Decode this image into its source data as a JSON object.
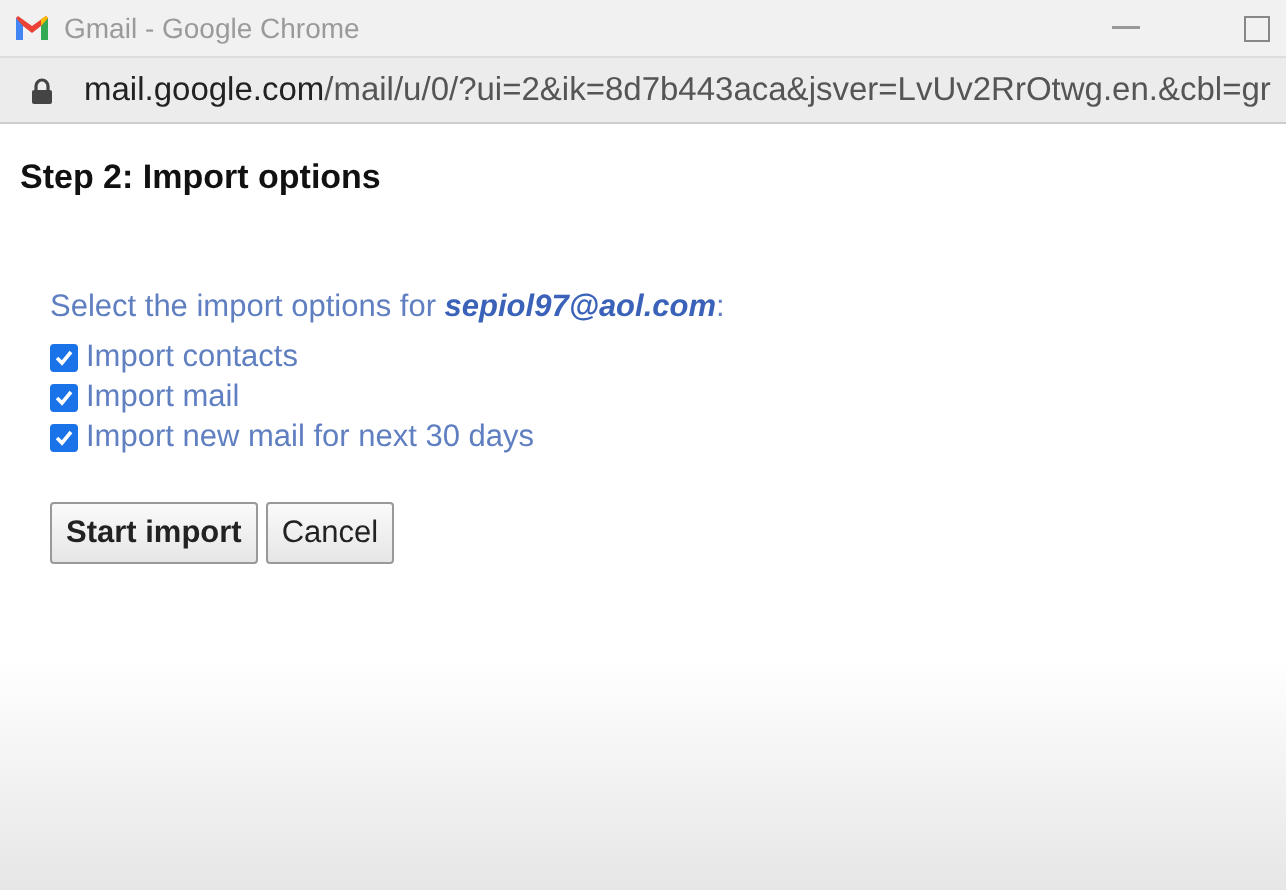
{
  "window": {
    "title": "Gmail - Google Chrome"
  },
  "address_bar": {
    "host": "mail.google.com",
    "path": "/mail/u/0/?ui=2&ik=8d7b443aca&jsver=LvUv2RrOtwg.en.&cbl=gr"
  },
  "heading": "Step 2: Import options",
  "prompt": {
    "text": "Select the import options for ",
    "email": "sepiol97@aol.com",
    "suffix": ":"
  },
  "options": [
    {
      "label": "Import contacts",
      "checked": true
    },
    {
      "label": "Import mail",
      "checked": true
    },
    {
      "label": "Import new mail for next 30 days",
      "checked": true
    }
  ],
  "buttons": [
    {
      "label": "Start import",
      "kind": "primary"
    },
    {
      "label": "Cancel",
      "kind": "secondary"
    }
  ]
}
